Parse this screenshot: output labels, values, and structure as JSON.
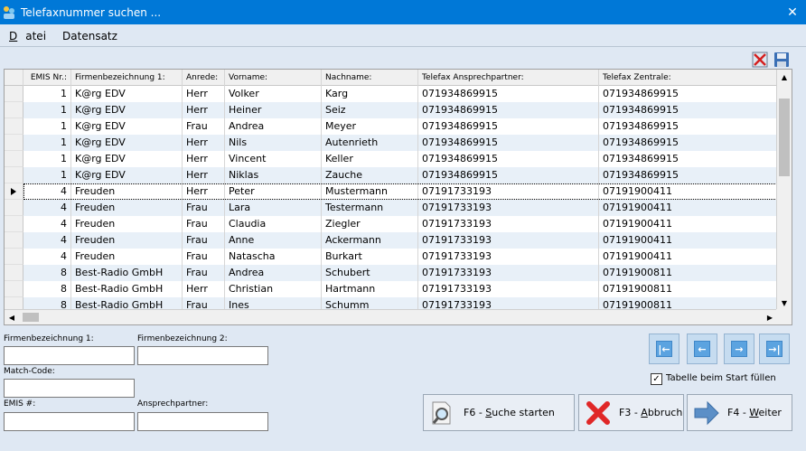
{
  "window": {
    "title": "Telefaxnummer suchen ..."
  },
  "menu": [
    {
      "pre": "D",
      "rest": "atei"
    },
    {
      "pre": "",
      "rest": "Datensatz"
    }
  ],
  "toolbar_icons": [
    "delete-icon",
    "save-icon"
  ],
  "grid": {
    "columns": [
      "EMIS Nr.:",
      "Firmenbezeichnung 1:",
      "Anrede:",
      "Vorname:",
      "Nachname:",
      "Telefax Ansprechpartner:",
      "Telefax Zentrale:"
    ],
    "rows": [
      [
        "1",
        "K@rg EDV",
        "Herr",
        "Volker",
        "Karg",
        "071934869915",
        "071934869915"
      ],
      [
        "1",
        "K@rg EDV",
        "Herr",
        "Heiner",
        "Seiz",
        "071934869915",
        "071934869915"
      ],
      [
        "1",
        "K@rg EDV",
        "Frau",
        "Andrea",
        "Meyer",
        "071934869915",
        "071934869915"
      ],
      [
        "1",
        "K@rg EDV",
        "Herr",
        "Nils",
        "Autenrieth",
        "071934869915",
        "071934869915"
      ],
      [
        "1",
        "K@rg EDV",
        "Herr",
        "Vincent",
        "Keller",
        "071934869915",
        "071934869915"
      ],
      [
        "1",
        "K@rg EDV",
        "Herr",
        "Niklas",
        "Zauche",
        "071934869915",
        "071934869915"
      ],
      [
        "4",
        "Freuden",
        "Herr",
        "Peter",
        "Mustermann",
        "07191733193",
        "07191900411"
      ],
      [
        "4",
        "Freuden",
        "Frau",
        "Lara",
        "Testermann",
        "07191733193",
        "07191900411"
      ],
      [
        "4",
        "Freuden",
        "Frau",
        "Claudia",
        "Ziegler",
        "07191733193",
        "07191900411"
      ],
      [
        "4",
        "Freuden",
        "Frau",
        "Anne",
        "Ackermann",
        "07191733193",
        "07191900411"
      ],
      [
        "4",
        "Freuden",
        "Frau",
        "Natascha",
        "Burkart",
        "07191733193",
        "07191900411"
      ],
      [
        "8",
        "Best-Radio GmbH",
        "Frau",
        "Andrea",
        "Schubert",
        "07191733193",
        "07191900811"
      ],
      [
        "8",
        "Best-Radio GmbH",
        "Herr",
        "Christian",
        "Hartmann",
        "07191733193",
        "07191900811"
      ],
      [
        "8",
        "Best-Radio GmbH",
        "Frau",
        "Ines",
        "Schumm",
        "07191733193",
        "07191900811"
      ]
    ],
    "current_row": 6
  },
  "search": {
    "firma1_label": "Firmenbezeichnung 1:",
    "firma1_value": "",
    "firma2_label": "Firmenbezeichnung 2:",
    "firma2_value": "",
    "matchcode_label": "Match-Code:",
    "matchcode_value": "",
    "emis_label": "EMIS #:",
    "emis_value": "",
    "ansprech_label": "Ansprechpartner:",
    "ansprech_value": ""
  },
  "nav_icons": [
    "first-record-icon",
    "prev-record-icon",
    "next-record-icon",
    "last-record-icon"
  ],
  "checkbox": {
    "label": "Tabelle beim Start füllen",
    "checked": true
  },
  "buttons": {
    "search": {
      "pre": "F6 - ",
      "key": "S",
      "rest": "uche starten"
    },
    "cancel": {
      "pre": "F3 - ",
      "key": "A",
      "rest": "bbruch"
    },
    "next": {
      "pre": "F4 - ",
      "key": "W",
      "rest": "eiter"
    }
  },
  "colors": {
    "titlebar": "#0078d7",
    "window_bg": "#dfe8f3",
    "alt_row": "#e8f0f8"
  }
}
